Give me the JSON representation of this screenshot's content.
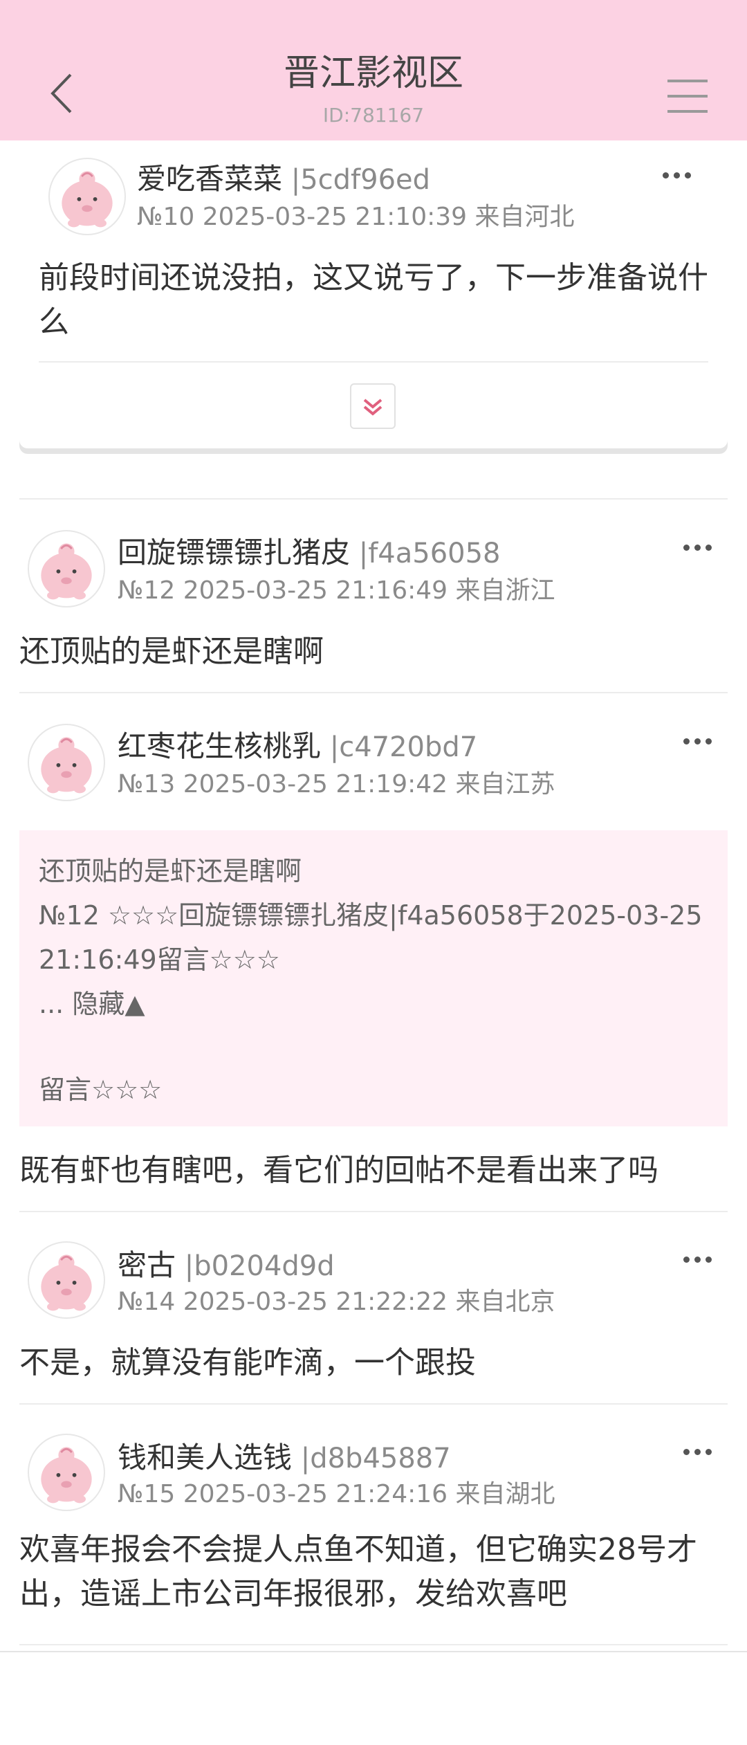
{
  "header": {
    "title": "晋江影视区",
    "subtitle": "ID:781167"
  },
  "posts": [
    {
      "username": "爱吃香菜菜",
      "uid": " |5cdf96ed",
      "meta": "№10 2025-03-25 21:10:39 来自河北",
      "content": "前段时间还说没拍，这又说亏了，下一步准备说什么"
    },
    {
      "username": "回旋镖镖镖扎猪皮",
      "uid": " |f4a56058",
      "meta": "№12 2025-03-25 21:16:49 来自浙江",
      "content": "还顶贴的是虾还是瞎啊"
    },
    {
      "username": "红枣花生核桃乳",
      "uid": " |c4720bd7",
      "meta": "№13 2025-03-25 21:19:42 来自江苏",
      "quote": {
        "line1": "还顶贴的是虾还是瞎啊",
        "line2": "№12 ☆☆☆回旋镖镖镖扎猪皮|f4a56058于2025-03-25",
        "line3": "21:16:49留言☆☆☆",
        "line4": "... 隐藏▲",
        "line5": "留言☆☆☆"
      },
      "content": "既有虾也有瞎吧，看它们的回帖不是看出来了吗"
    },
    {
      "username": "密古",
      "uid": " |b0204d9d",
      "meta": "№14 2025-03-25 21:22:22 来自北京",
      "content": "不是，就算没有能咋滴，一个跟投"
    },
    {
      "username": "钱和美人选钱",
      "uid": " |d8b45887",
      "meta": "№15 2025-03-25 21:24:16 来自湖北",
      "content": "欢喜年报会不会提人点鱼不知道，但它确实28号才出，造谣上市公司年报很邪，发给欢喜吧"
    }
  ]
}
